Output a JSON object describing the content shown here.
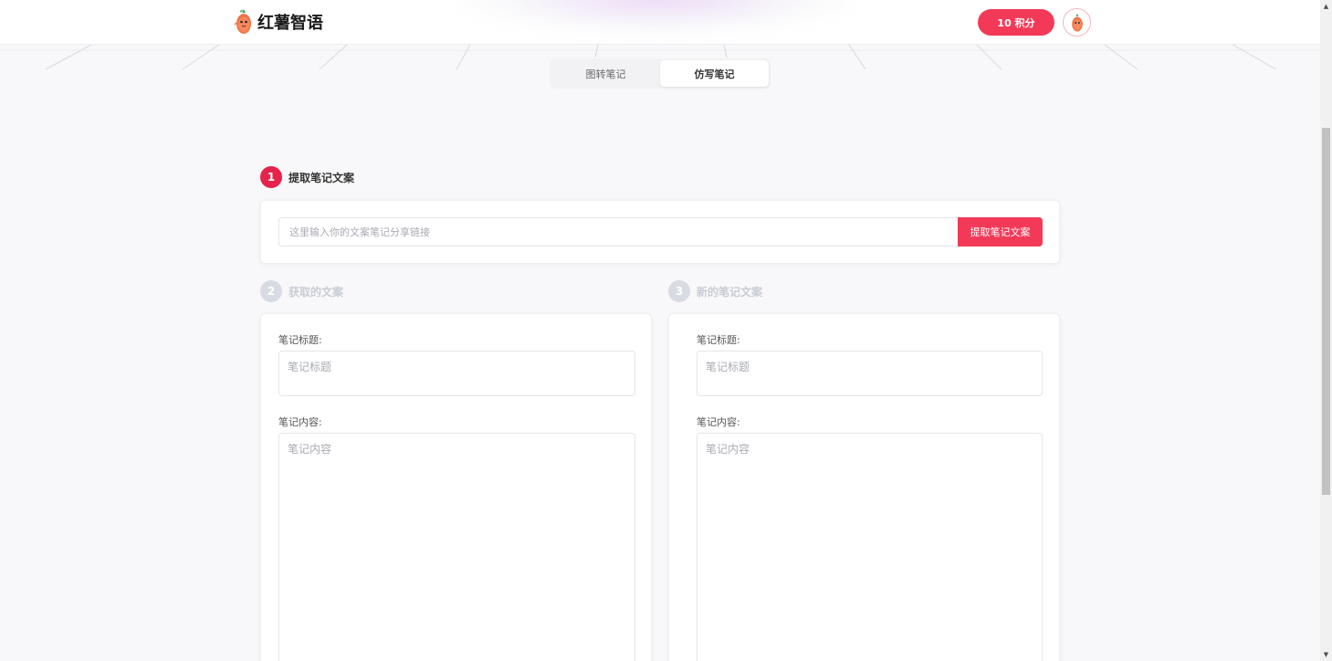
{
  "header": {
    "brand": "红薯智语",
    "points_label": "10 积分"
  },
  "tabs": [
    {
      "label": "图转笔记",
      "active": false
    },
    {
      "label": "仿写笔记",
      "active": true
    }
  ],
  "step1": {
    "number": "1",
    "title": "提取笔记文案",
    "input_placeholder": "这里输入你的文案笔记分享链接",
    "input_value": "",
    "button_label": "提取笔记文案"
  },
  "step2": {
    "number": "2",
    "title": "获取的文案",
    "title_label": "笔记标题:",
    "title_placeholder": "笔记标题",
    "content_label": "笔记内容:",
    "content_placeholder": "笔记内容"
  },
  "step3": {
    "number": "3",
    "title": "新的笔记文案",
    "title_label": "笔记标题:",
    "title_placeholder": "笔记标题",
    "content_label": "笔记内容:",
    "content_placeholder": "笔记内容"
  },
  "colors": {
    "accent": "#f23a58",
    "step_active": "#e5234b",
    "step_inactive": "#d8dbe2"
  },
  "icons": {
    "logo": "sweet-potato-mascot-icon",
    "avatar": "sweet-potato-mascot-icon"
  }
}
